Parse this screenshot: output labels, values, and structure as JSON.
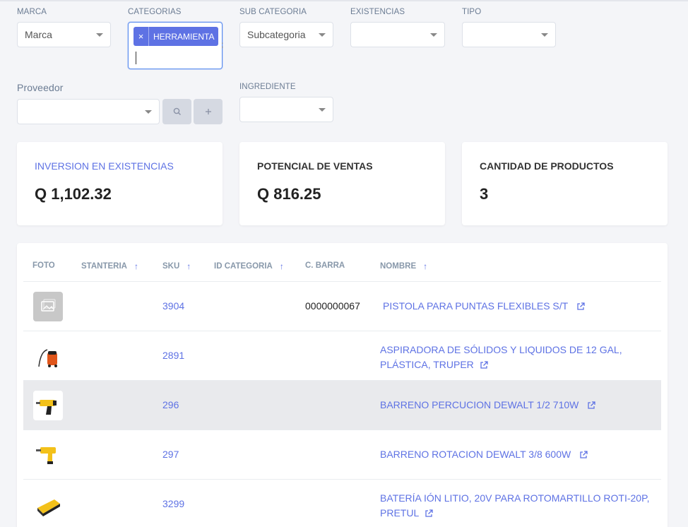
{
  "filters": {
    "marca": {
      "label": "MARCA",
      "placeholder": "Marca"
    },
    "categorias": {
      "label": "CATEGORIAS",
      "tags": [
        "HERRAMIENTA"
      ],
      "remove_glyph": "×"
    },
    "subcategoria": {
      "label": "SUB CATEGORIA",
      "placeholder": "Subcategoria"
    },
    "existencias": {
      "label": "EXISTENCIAS",
      "value": ""
    },
    "tipo": {
      "label": "TIPO",
      "value": ""
    },
    "proveedor": {
      "label": "Proveedor",
      "value": ""
    },
    "ingrediente": {
      "label": "INGREDIENTE",
      "value": ""
    },
    "search_icon": "search-icon",
    "add_icon": "plus-icon"
  },
  "cards": [
    {
      "title": "INVERSION EN EXISTENCIAS",
      "value": "Q 1,102.32"
    },
    {
      "title": "POTENCIAL DE VENTAS",
      "value": "Q 816.25"
    },
    {
      "title": "CANTIDAD DE PRODUCTOS",
      "value": "3"
    }
  ],
  "table": {
    "headers": {
      "foto": "FOTO",
      "stanteria": "STANTERIA",
      "sku": "SKU",
      "id_categoria": "ID CATEGORIA",
      "c_barra": "C. BARRA",
      "nombre": "NOMBRE"
    },
    "sort_arrow": "↑",
    "rows": [
      {
        "sku": "3904",
        "barcode": "0000000067",
        "name": "PISTOLA PARA PUNTAS FLEXIBLES S/T",
        "thumb": "placeholder-image-icon"
      },
      {
        "sku": "2891",
        "barcode": "",
        "name": "ASPIRADORA DE SÓLIDOS Y LIQUIDOS DE 12 GAL,",
        "name2": "PLÁSTICA, TRUPER",
        "thumb": "vacuum-image"
      },
      {
        "sku": "296",
        "barcode": "",
        "name": "BARRENO PERCUCION DEWALT 1/2 710W",
        "thumb": "drill-image"
      },
      {
        "sku": "297",
        "barcode": "",
        "name": "BARRENO ROTACION DEWALT 3/8 600W",
        "thumb": "drill-image"
      },
      {
        "sku": "3299",
        "barcode": "",
        "name": "BATERÍA IÓN LITIO, 20V PARA ROTOMARTILLO ROTI-20P,",
        "name2": "PRETUL",
        "thumb": "battery-image"
      }
    ]
  },
  "colors": {
    "accent": "#5e72e4",
    "header_text": "#8898aa",
    "highlight_row": "#e9eaed"
  }
}
